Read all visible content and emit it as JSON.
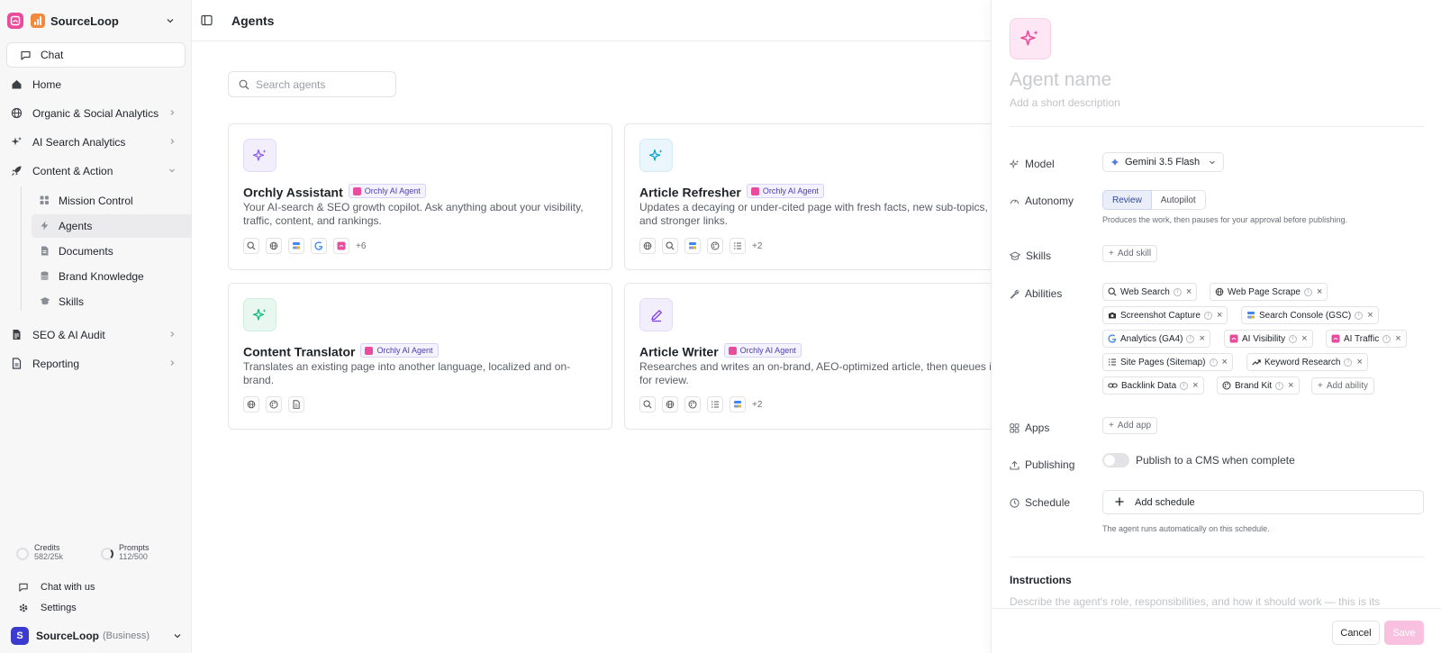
{
  "sidebar": {
    "workspace_name": "SourceLoop",
    "chat_label": "Chat",
    "nav": [
      {
        "label": "Home"
      },
      {
        "label": "Organic & Social Analytics"
      },
      {
        "label": "AI Search Analytics"
      },
      {
        "label": "Content & Action"
      },
      {
        "label": "SEO & AI Audit"
      },
      {
        "label": "Reporting"
      }
    ],
    "subnav": [
      {
        "label": "Mission Control"
      },
      {
        "label": "Agents",
        "active": true
      },
      {
        "label": "Documents"
      },
      {
        "label": "Brand Knowledge"
      },
      {
        "label": "Skills"
      }
    ],
    "credits": {
      "label": "Credits",
      "value": "582/25k"
    },
    "prompts": {
      "label": "Prompts",
      "value": "112/500"
    },
    "chat_with_us": "Chat with us",
    "settings": "Settings",
    "account": {
      "avatar_letter": "S",
      "name": "SourceLoop",
      "tier": "(Business)"
    }
  },
  "header": {
    "title": "Agents"
  },
  "search": {
    "placeholder": "Search agents"
  },
  "cards": [
    {
      "title": "Orchly Assistant",
      "badge": "Orchly AI Agent",
      "description": "Your AI-search & SEO growth copilot. Ask anything about your visibility, traffic, content, and rankings.",
      "more": "+6",
      "icon": "sparkles-icon"
    },
    {
      "title": "Article Refresher",
      "badge": "Orchly AI Agent",
      "description": "Updates a decaying or under-cited page with fresh facts, new sub-topics, and stronger links.",
      "more": "+2",
      "icon": "sparkles-icon"
    },
    {
      "title": "Content Translator",
      "badge": "Orchly AI Agent",
      "description": "Translates an existing page into another language, localized and on-brand.",
      "more": "",
      "icon": "sparkles-icon"
    },
    {
      "title": "Article Writer",
      "badge": "Orchly AI Agent",
      "description": "Researches and writes an on-brand, AEO-optimized article, then queues it for review.",
      "more": "+2",
      "icon": "pen-icon"
    }
  ],
  "panel": {
    "name_placeholder": "Agent name",
    "description_placeholder": "Add a short description",
    "model_label": "Model",
    "model_value": "Gemini 3.5 Flash",
    "autonomy_label": "Autonomy",
    "autonomy_options": [
      "Review",
      "Autopilot"
    ],
    "autonomy_hint": "Produces the work, then pauses for your approval before publishing.",
    "skills_label": "Skills",
    "add_skill": "Add skill",
    "abilities_label": "Abilities",
    "abilities": [
      "Web Search",
      "Web Page Scrape",
      "Screenshot Capture",
      "Search Console (GSC)",
      "Analytics (GA4)",
      "AI Visibility",
      "AI Traffic",
      "Site Pages (Sitemap)",
      "Keyword Research",
      "Backlink Data",
      "Brand Kit"
    ],
    "add_ability": "Add ability",
    "apps_label": "Apps",
    "add_app": "Add app",
    "publishing_label": "Publishing",
    "publish_toggle": "Publish to a CMS when complete",
    "schedule_label": "Schedule",
    "add_schedule": "Add schedule",
    "schedule_hint": "The agent runs automatically on this schedule.",
    "instructions_label": "Instructions",
    "instructions_placeholder": "Describe the agent's role, responsibilities, and how it should work — this is its",
    "cancel": "Cancel",
    "save": "Save"
  },
  "colors": {
    "brand_pink": "#e94c9d",
    "accent_blue": "#2f4aa0",
    "save_disabled": "#f9c1df"
  }
}
